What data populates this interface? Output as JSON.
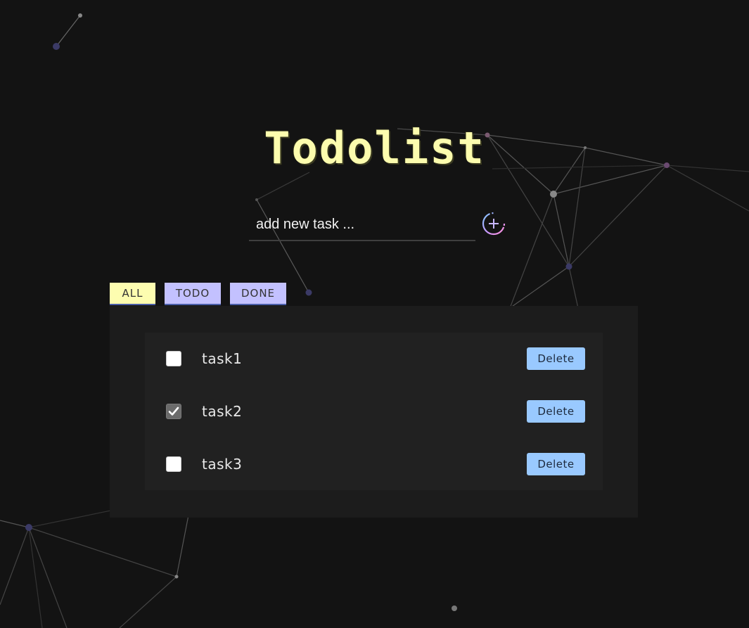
{
  "app": {
    "title": "Todolist"
  },
  "new_task": {
    "placeholder": "add new task ...",
    "value": "",
    "add_icon": "plus-circle-icon"
  },
  "filters": {
    "tabs": [
      {
        "label": "ALL",
        "active": true
      },
      {
        "label": "TODO",
        "active": false
      },
      {
        "label": "DONE",
        "active": false
      }
    ]
  },
  "tasks": [
    {
      "label": "task1",
      "done": false,
      "delete_label": "Delete"
    },
    {
      "label": "task2",
      "done": true,
      "delete_label": "Delete"
    },
    {
      "label": "task3",
      "done": false,
      "delete_label": "Delete"
    }
  ],
  "colors": {
    "background": "#131313",
    "title": "#fcfcae",
    "tab_active": "#fdfdb0",
    "tab_inactive": "#c3c1ff",
    "delete_button": "#99c9ff"
  }
}
